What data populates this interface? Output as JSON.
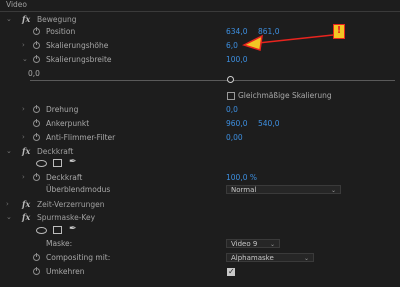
{
  "panel": {
    "title": "Video"
  },
  "bewegung": {
    "title": "Bewegung",
    "position": {
      "label": "Position",
      "x": "634,0",
      "y": "861,0"
    },
    "skalierungshoehe": {
      "label": "Skalierungshöhe",
      "value": "6,0"
    },
    "skalierungsbreite": {
      "label": "Skalierungsbreite",
      "value": "100,0"
    },
    "slider": {
      "min_label": "0,0",
      "level_fraction": 0.06
    },
    "gleichmaessig": {
      "label": "Gleichmäßige Skalierung",
      "checked": false
    },
    "drehung": {
      "label": "Drehung",
      "value": "0,0"
    },
    "ankerpunkt": {
      "label": "Ankerpunkt",
      "x": "960,0",
      "y": "540,0"
    },
    "antiflimmer": {
      "label": "Anti-Flimmer-Filter",
      "value": "0,00"
    }
  },
  "deckkraft": {
    "title": "Deckkraft",
    "deckkraft": {
      "label": "Deckkraft",
      "value": "100,0 %"
    },
    "ueberblendmodus": {
      "label": "Überblendmodus",
      "value": "Normal"
    }
  },
  "zeit": {
    "title": "Zeit-Verzerrungen"
  },
  "spurmaske": {
    "title": "Spurmaske-Key",
    "maske": {
      "label": "Maske:",
      "value": "Video 9"
    },
    "compositing": {
      "label": "Compositing mit:",
      "value": "Alphamaske"
    },
    "umkehren": {
      "label": "Umkehren",
      "checked": true
    }
  },
  "annotation": {
    "marker": "!",
    "color": "#e8241e",
    "box_color": "#f2c524"
  },
  "icons": {
    "fx": "fx",
    "stopwatch": "stopwatch-icon",
    "pen": "✒"
  }
}
